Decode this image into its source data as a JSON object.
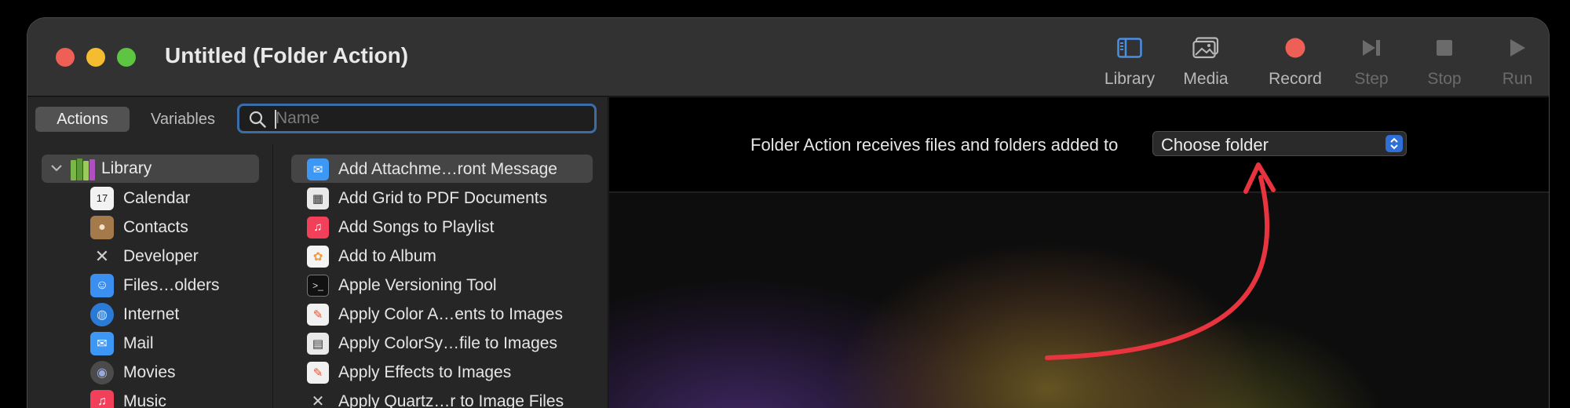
{
  "window": {
    "title": "Untitled (Folder Action)"
  },
  "toolbar": {
    "library": "Library",
    "media": "Media",
    "record": "Record",
    "step": "Step",
    "stop": "Stop",
    "run": "Run"
  },
  "sidebar": {
    "tabs": {
      "actions": "Actions",
      "variables": "Variables"
    },
    "search": {
      "placeholder": "Name",
      "value": ""
    },
    "library": {
      "label": "Library"
    },
    "categories": [
      "Calendar",
      "Contacts",
      "Developer",
      "Files…olders",
      "Internet",
      "Mail",
      "Movies",
      "Music"
    ]
  },
  "actions": [
    "Add Attachme…ront Message",
    "Add Grid to PDF Documents",
    "Add Songs to Playlist",
    "Add to Album",
    "Apple Versioning Tool",
    "Apply Color A…ents to Images",
    "Apply ColorSy…file to Images",
    "Apply Effects to Images",
    "Apply Quartz…r to Image Files"
  ],
  "workflow": {
    "receive_label": "Folder Action receives files and folders added to",
    "folder_select": "Choose folder"
  },
  "colors": {
    "accent": "#2f6fd8",
    "record": "#ee5f56",
    "arrow": "#e8343f"
  }
}
